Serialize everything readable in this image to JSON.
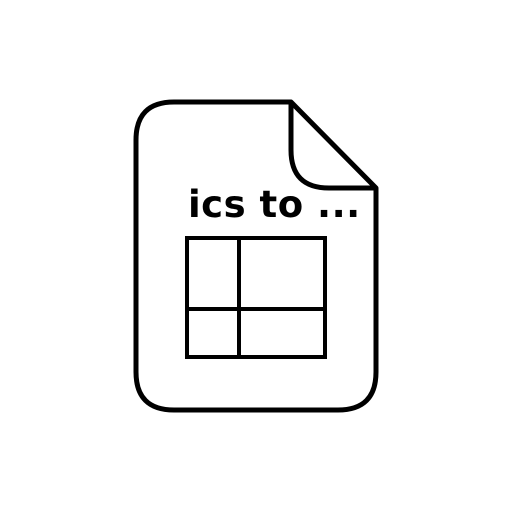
{
  "icon": {
    "name": "ics-file-conversion-icon",
    "label": "ics to ...",
    "stroke_color": "#000000",
    "background_color": "#ffffff"
  }
}
